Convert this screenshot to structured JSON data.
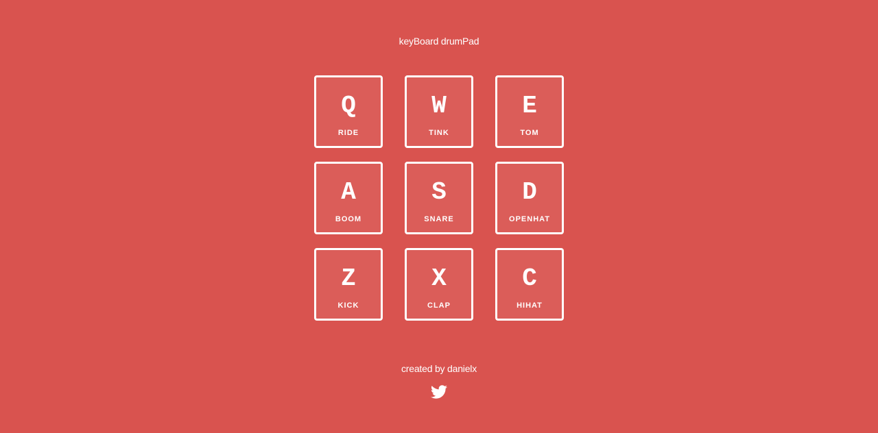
{
  "app": {
    "title": "keyBoard drumPad"
  },
  "pads": [
    {
      "key": "Q",
      "sound": "RIDE"
    },
    {
      "key": "W",
      "sound": "TINK"
    },
    {
      "key": "E",
      "sound": "TOM"
    },
    {
      "key": "A",
      "sound": "BOOM"
    },
    {
      "key": "S",
      "sound": "SNARE"
    },
    {
      "key": "D",
      "sound": "OPENHAT"
    },
    {
      "key": "Z",
      "sound": "KICK"
    },
    {
      "key": "X",
      "sound": "CLAP"
    },
    {
      "key": "C",
      "sound": "HIHAT"
    }
  ],
  "footer": {
    "credit": "created by danielx",
    "social_icon": "twitter-icon"
  },
  "colors": {
    "background": "#d9534f",
    "foreground": "#ffffff"
  }
}
